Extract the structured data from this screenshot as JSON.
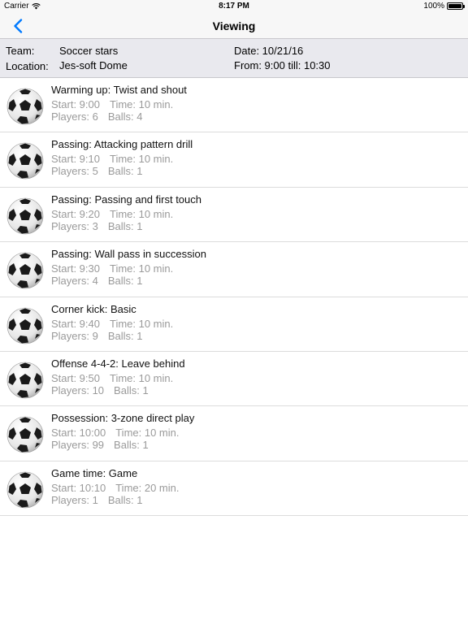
{
  "status_bar": {
    "carrier": "Carrier",
    "time": "8:17 PM",
    "battery": "100%"
  },
  "nav": {
    "title": "Viewing"
  },
  "info": {
    "team_label": "Team:",
    "team_value": "Soccer stars",
    "location_label": "Location:",
    "location_value": "Jes-soft Dome",
    "date_text": "Date: 10/21/16",
    "from_text": "From: 9:00 till: 10:30"
  },
  "drills": [
    {
      "name": "Warming up: Twist and shout",
      "start": "Start: 9:00",
      "time": "Time: 10 min.",
      "players": "Players: 6",
      "balls": "Balls: 4"
    },
    {
      "name": "Passing: Attacking pattern drill",
      "start": "Start: 9:10",
      "time": "Time: 10 min.",
      "players": "Players: 5",
      "balls": "Balls: 1"
    },
    {
      "name": "Passing: Passing and first touch",
      "start": "Start: 9:20",
      "time": "Time: 10 min.",
      "players": "Players: 3",
      "balls": "Balls: 1"
    },
    {
      "name": "Passing: Wall pass in succession",
      "start": "Start: 9:30",
      "time": "Time: 10 min.",
      "players": "Players: 4",
      "balls": "Balls: 1"
    },
    {
      "name": "Corner kick: Basic",
      "start": "Start: 9:40",
      "time": "Time: 10 min.",
      "players": "Players: 9",
      "balls": "Balls: 1"
    },
    {
      "name": "Offense 4-4-2: Leave behind",
      "start": "Start: 9:50",
      "time": "Time: 10 min.",
      "players": "Players: 10",
      "balls": "Balls: 1"
    },
    {
      "name": "Possession: 3-zone direct play",
      "start": "Start: 10:00",
      "time": "Time: 10 min.",
      "players": "Players: 99",
      "balls": "Balls: 1"
    },
    {
      "name": "Game time: Game",
      "start": "Start: 10:10",
      "time": "Time: 20 min.",
      "players": "Players: 1",
      "balls": "Balls: 1"
    }
  ],
  "icons": {
    "back": "chevron-left-icon",
    "wifi": "wifi-icon",
    "battery": "battery-icon",
    "drill": "soccer-ball-icon"
  },
  "colors": {
    "accent": "#007aff",
    "subtext": "#9a9a9a",
    "info_bg": "#e9e9ee"
  }
}
